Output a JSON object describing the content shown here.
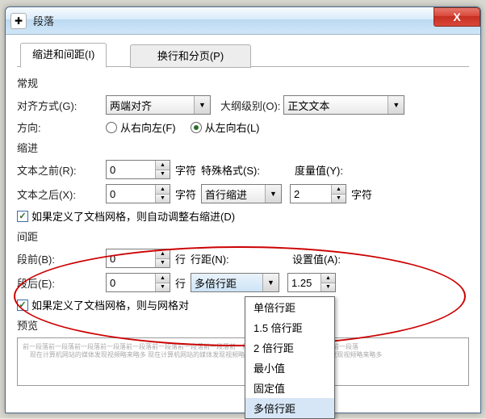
{
  "window": {
    "title": "段落",
    "close": "X"
  },
  "tabs": {
    "tab1": "缩进和间距(I)",
    "tab2": "换行和分页(P)"
  },
  "general": {
    "title": "常规",
    "align_label": "对齐方式(G):",
    "align_value": "两端对齐",
    "outline_label": "大纲级别(O):",
    "outline_value": "正文文本",
    "direction_label": "方向:",
    "rtl": "从右向左(F)",
    "ltr": "从左向右(L)"
  },
  "indent": {
    "title": "缩进",
    "before_label": "文本之前(R):",
    "before_value": "0",
    "after_label": "文本之后(X):",
    "after_value": "0",
    "unit": "字符",
    "special_label": "特殊格式(S):",
    "special_value": "首行缩进",
    "measure_label": "度量值(Y):",
    "measure_value": "2",
    "measure_unit": "字符",
    "grid_check": "如果定义了文档网格，则自动调整右缩进(D)"
  },
  "spacing": {
    "title": "间距",
    "before_label": "段前(B):",
    "before_value": "0",
    "after_label": "段后(E):",
    "after_value": "0",
    "unit": "行",
    "linespacing_label": "行距(N):",
    "linespacing_value": "多倍行距",
    "setvalue_label": "设置值(A):",
    "setvalue_value": "1.25",
    "grid_check": "如果定义了文档网格，则与网格对",
    "options": [
      "单倍行距",
      "1.5 倍行距",
      "2 倍行距",
      "最小值",
      "固定值",
      "多倍行距"
    ]
  },
  "preview": {
    "title": "预览"
  }
}
